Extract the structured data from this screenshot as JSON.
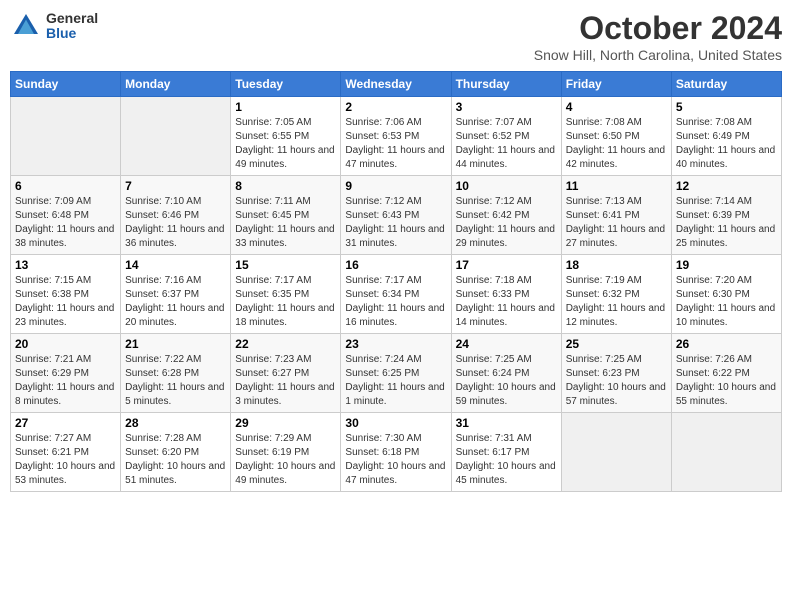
{
  "logo": {
    "general": "General",
    "blue": "Blue"
  },
  "title": "October 2024",
  "location": "Snow Hill, North Carolina, United States",
  "days_header": [
    "Sunday",
    "Monday",
    "Tuesday",
    "Wednesday",
    "Thursday",
    "Friday",
    "Saturday"
  ],
  "weeks": [
    [
      {
        "day": "",
        "sunrise": "",
        "sunset": "",
        "daylight": ""
      },
      {
        "day": "",
        "sunrise": "",
        "sunset": "",
        "daylight": ""
      },
      {
        "day": "1",
        "sunrise": "Sunrise: 7:05 AM",
        "sunset": "Sunset: 6:55 PM",
        "daylight": "Daylight: 11 hours and 49 minutes."
      },
      {
        "day": "2",
        "sunrise": "Sunrise: 7:06 AM",
        "sunset": "Sunset: 6:53 PM",
        "daylight": "Daylight: 11 hours and 47 minutes."
      },
      {
        "day": "3",
        "sunrise": "Sunrise: 7:07 AM",
        "sunset": "Sunset: 6:52 PM",
        "daylight": "Daylight: 11 hours and 44 minutes."
      },
      {
        "day": "4",
        "sunrise": "Sunrise: 7:08 AM",
        "sunset": "Sunset: 6:50 PM",
        "daylight": "Daylight: 11 hours and 42 minutes."
      },
      {
        "day": "5",
        "sunrise": "Sunrise: 7:08 AM",
        "sunset": "Sunset: 6:49 PM",
        "daylight": "Daylight: 11 hours and 40 minutes."
      }
    ],
    [
      {
        "day": "6",
        "sunrise": "Sunrise: 7:09 AM",
        "sunset": "Sunset: 6:48 PM",
        "daylight": "Daylight: 11 hours and 38 minutes."
      },
      {
        "day": "7",
        "sunrise": "Sunrise: 7:10 AM",
        "sunset": "Sunset: 6:46 PM",
        "daylight": "Daylight: 11 hours and 36 minutes."
      },
      {
        "day": "8",
        "sunrise": "Sunrise: 7:11 AM",
        "sunset": "Sunset: 6:45 PM",
        "daylight": "Daylight: 11 hours and 33 minutes."
      },
      {
        "day": "9",
        "sunrise": "Sunrise: 7:12 AM",
        "sunset": "Sunset: 6:43 PM",
        "daylight": "Daylight: 11 hours and 31 minutes."
      },
      {
        "day": "10",
        "sunrise": "Sunrise: 7:12 AM",
        "sunset": "Sunset: 6:42 PM",
        "daylight": "Daylight: 11 hours and 29 minutes."
      },
      {
        "day": "11",
        "sunrise": "Sunrise: 7:13 AM",
        "sunset": "Sunset: 6:41 PM",
        "daylight": "Daylight: 11 hours and 27 minutes."
      },
      {
        "day": "12",
        "sunrise": "Sunrise: 7:14 AM",
        "sunset": "Sunset: 6:39 PM",
        "daylight": "Daylight: 11 hours and 25 minutes."
      }
    ],
    [
      {
        "day": "13",
        "sunrise": "Sunrise: 7:15 AM",
        "sunset": "Sunset: 6:38 PM",
        "daylight": "Daylight: 11 hours and 23 minutes."
      },
      {
        "day": "14",
        "sunrise": "Sunrise: 7:16 AM",
        "sunset": "Sunset: 6:37 PM",
        "daylight": "Daylight: 11 hours and 20 minutes."
      },
      {
        "day": "15",
        "sunrise": "Sunrise: 7:17 AM",
        "sunset": "Sunset: 6:35 PM",
        "daylight": "Daylight: 11 hours and 18 minutes."
      },
      {
        "day": "16",
        "sunrise": "Sunrise: 7:17 AM",
        "sunset": "Sunset: 6:34 PM",
        "daylight": "Daylight: 11 hours and 16 minutes."
      },
      {
        "day": "17",
        "sunrise": "Sunrise: 7:18 AM",
        "sunset": "Sunset: 6:33 PM",
        "daylight": "Daylight: 11 hours and 14 minutes."
      },
      {
        "day": "18",
        "sunrise": "Sunrise: 7:19 AM",
        "sunset": "Sunset: 6:32 PM",
        "daylight": "Daylight: 11 hours and 12 minutes."
      },
      {
        "day": "19",
        "sunrise": "Sunrise: 7:20 AM",
        "sunset": "Sunset: 6:30 PM",
        "daylight": "Daylight: 11 hours and 10 minutes."
      }
    ],
    [
      {
        "day": "20",
        "sunrise": "Sunrise: 7:21 AM",
        "sunset": "Sunset: 6:29 PM",
        "daylight": "Daylight: 11 hours and 8 minutes."
      },
      {
        "day": "21",
        "sunrise": "Sunrise: 7:22 AM",
        "sunset": "Sunset: 6:28 PM",
        "daylight": "Daylight: 11 hours and 5 minutes."
      },
      {
        "day": "22",
        "sunrise": "Sunrise: 7:23 AM",
        "sunset": "Sunset: 6:27 PM",
        "daylight": "Daylight: 11 hours and 3 minutes."
      },
      {
        "day": "23",
        "sunrise": "Sunrise: 7:24 AM",
        "sunset": "Sunset: 6:25 PM",
        "daylight": "Daylight: 11 hours and 1 minute."
      },
      {
        "day": "24",
        "sunrise": "Sunrise: 7:25 AM",
        "sunset": "Sunset: 6:24 PM",
        "daylight": "Daylight: 10 hours and 59 minutes."
      },
      {
        "day": "25",
        "sunrise": "Sunrise: 7:25 AM",
        "sunset": "Sunset: 6:23 PM",
        "daylight": "Daylight: 10 hours and 57 minutes."
      },
      {
        "day": "26",
        "sunrise": "Sunrise: 7:26 AM",
        "sunset": "Sunset: 6:22 PM",
        "daylight": "Daylight: 10 hours and 55 minutes."
      }
    ],
    [
      {
        "day": "27",
        "sunrise": "Sunrise: 7:27 AM",
        "sunset": "Sunset: 6:21 PM",
        "daylight": "Daylight: 10 hours and 53 minutes."
      },
      {
        "day": "28",
        "sunrise": "Sunrise: 7:28 AM",
        "sunset": "Sunset: 6:20 PM",
        "daylight": "Daylight: 10 hours and 51 minutes."
      },
      {
        "day": "29",
        "sunrise": "Sunrise: 7:29 AM",
        "sunset": "Sunset: 6:19 PM",
        "daylight": "Daylight: 10 hours and 49 minutes."
      },
      {
        "day": "30",
        "sunrise": "Sunrise: 7:30 AM",
        "sunset": "Sunset: 6:18 PM",
        "daylight": "Daylight: 10 hours and 47 minutes."
      },
      {
        "day": "31",
        "sunrise": "Sunrise: 7:31 AM",
        "sunset": "Sunset: 6:17 PM",
        "daylight": "Daylight: 10 hours and 45 minutes."
      },
      {
        "day": "",
        "sunrise": "",
        "sunset": "",
        "daylight": ""
      },
      {
        "day": "",
        "sunrise": "",
        "sunset": "",
        "daylight": ""
      }
    ]
  ]
}
